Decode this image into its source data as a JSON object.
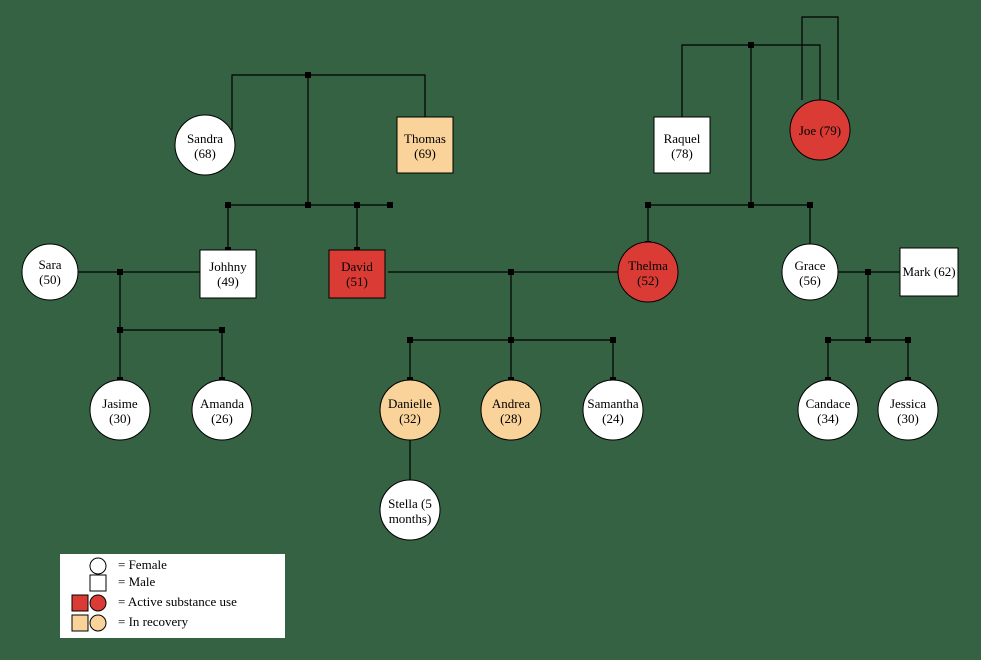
{
  "nodes": {
    "sandra": {
      "label": "Sandra",
      "age": "(68)"
    },
    "thomas": {
      "label": "Thomas",
      "age": "(69)"
    },
    "raquel": {
      "label": "Raquel",
      "age": "(78)"
    },
    "joe": {
      "label": "Joe (79)",
      "age": ""
    },
    "sara": {
      "label": "Sara",
      "age": "(50)"
    },
    "johnny": {
      "label": "Johhny",
      "age": "(49)"
    },
    "david": {
      "label": "David",
      "age": "(51)"
    },
    "thelma": {
      "label": "Thelma",
      "age": "(52)"
    },
    "grace": {
      "label": "Grace",
      "age": "(56)"
    },
    "mark": {
      "label": "Mark (62)",
      "age": ""
    },
    "jasime": {
      "label": "Jasime",
      "age": "(30)"
    },
    "amanda": {
      "label": "Amanda",
      "age": "(26)"
    },
    "danielle": {
      "label": "Danielle",
      "age": "(32)"
    },
    "andrea": {
      "label": "Andrea",
      "age": "(28)"
    },
    "samantha": {
      "label": "Samantha",
      "age": "(24)"
    },
    "stella": {
      "label": "Stella (5",
      "age": "months)"
    },
    "candace": {
      "label": "Candace",
      "age": "(34)"
    },
    "jessica": {
      "label": "Jessica",
      "age": "(30)"
    }
  },
  "legend": {
    "female": "= Female",
    "male": "= Male",
    "active": "= Active substance use",
    "recovery": "= In recovery"
  }
}
